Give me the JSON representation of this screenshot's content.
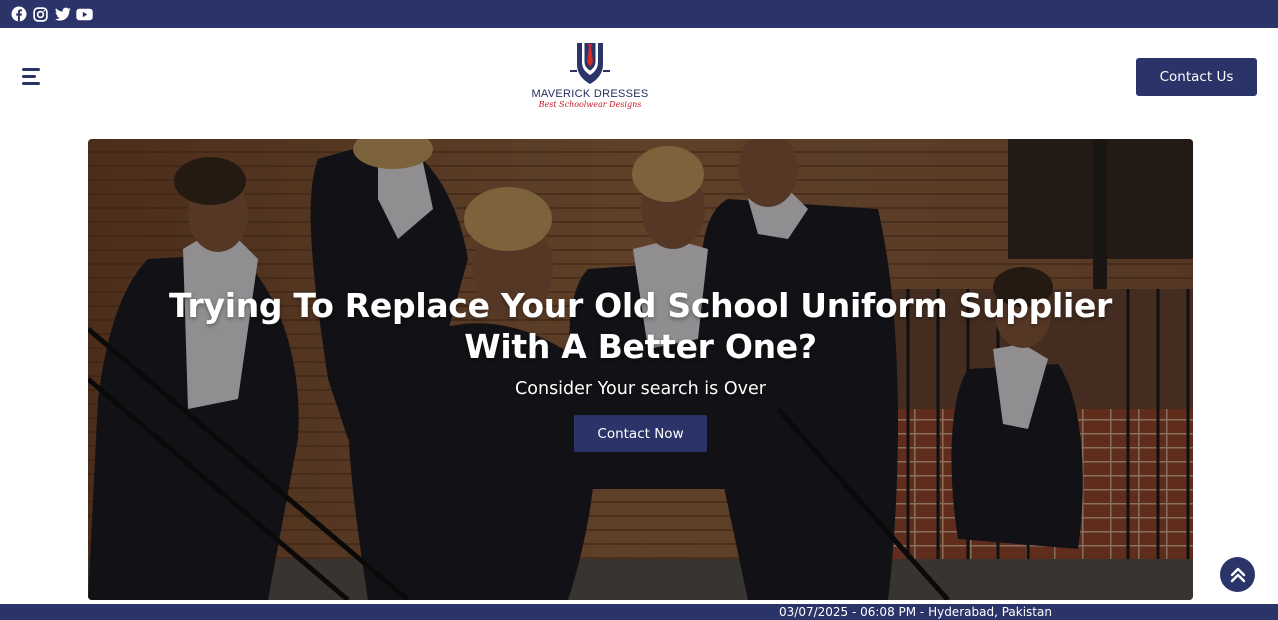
{
  "topbar": {
    "social": [
      "facebook-icon",
      "instagram-icon",
      "twitter-icon",
      "youtube-icon"
    ]
  },
  "header": {
    "menu_icon": "hamburger-icon",
    "logo": {
      "name": "MAVERICK DRESSES",
      "tagline": "Best Schoolwear Designs"
    },
    "contact_label": "Contact Us"
  },
  "hero": {
    "title_line1": "Trying To Replace Your Old School Uniform Supplier",
    "title_line2": "With A Better One?",
    "subtitle": "Consider Your search is Over",
    "cta_label": "Contact Now"
  },
  "scroll_top_icon": "double-chevron-up-icon",
  "footer": {
    "text": "03/07/2025 - 06:08 PM - Hyderabad, Pakistan"
  },
  "colors": {
    "brand": "#2a3468",
    "accent": "#c3202b",
    "white": "#ffffff"
  }
}
